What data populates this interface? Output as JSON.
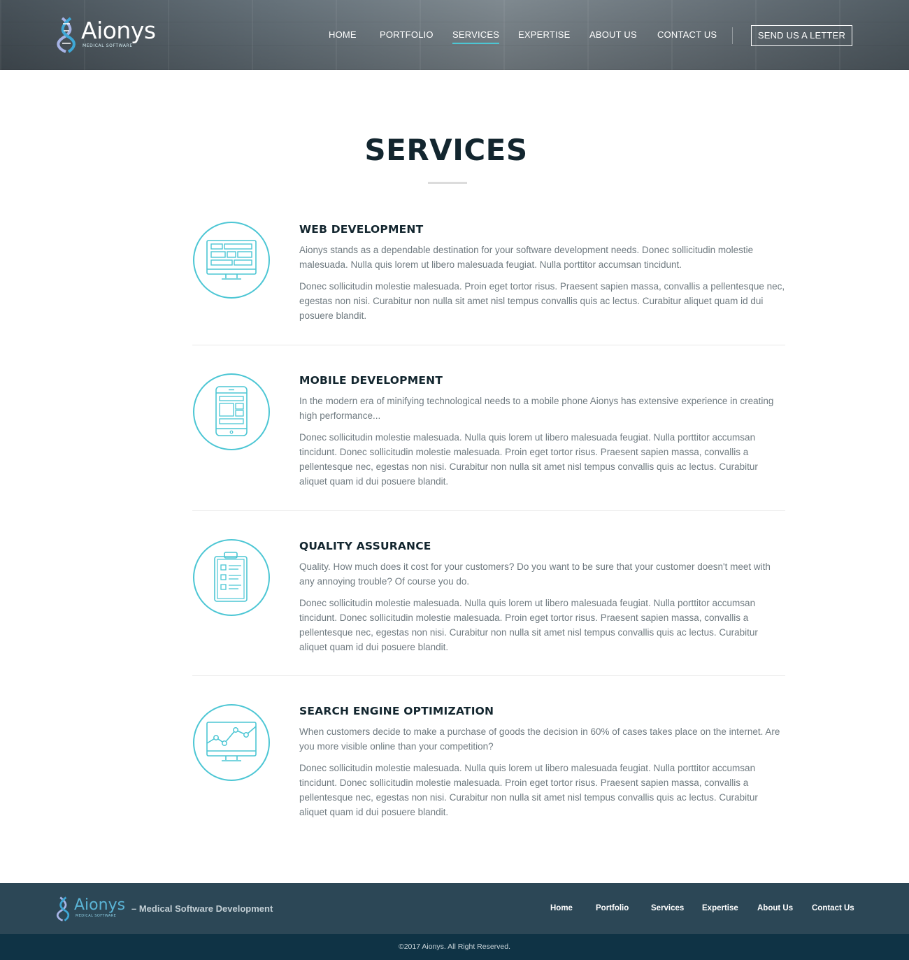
{
  "header": {
    "logo_name": "Aionys",
    "logo_sub": "MEDICAL SOFTWARE",
    "nav": [
      {
        "label": "HOME"
      },
      {
        "label": "PORTFOLIO"
      },
      {
        "label": "SERVICES",
        "active": true
      },
      {
        "label": "EXPERTISE"
      },
      {
        "label": "ABOUT US"
      },
      {
        "label": "CONTACT US"
      }
    ],
    "cta_label": "SEND US A LETTER"
  },
  "main": {
    "title": "SERVICES",
    "services": [
      {
        "icon": "monitor-layout-icon",
        "title": "WEB DEVELOPMENT",
        "paragraphs": [
          "Aionys stands as a dependable destination for your software development needs. Donec sollicitudin molestie malesuada. Nulla quis lorem ut libero malesuada feugiat. Nulla porttitor accumsan tincidunt.",
          "Donec sollicitudin molestie malesuada. Proin eget tortor risus. Praesent sapien massa, convallis a pellentesque nec, egestas non nisi. Curabitur non nulla sit amet nisl tempus convallis quis ac lectus. Curabitur aliquet quam id dui posuere blandit."
        ]
      },
      {
        "icon": "mobile-phone-icon",
        "title": "MOBILE DEVELOPMENT",
        "paragraphs": [
          "In the modern era of minifying technological needs to a mobile phone Aionys has extensive experience in creating high performance...",
          "Donec sollicitudin molestie malesuada. Nulla quis lorem ut libero malesuada feugiat. Nulla porttitor accumsan tincidunt. Donec sollicitudin molestie malesuada. Proin eget tortor risus. Praesent sapien massa, convallis a pellentesque nec, egestas non nisi. Curabitur non nulla sit amet nisl tempus convallis quis ac lectus. Curabitur aliquet quam id dui posuere blandit."
        ]
      },
      {
        "icon": "clipboard-checklist-icon",
        "title": "QUALITY ASSURANCE",
        "paragraphs": [
          "Quality. How much does it cost for your customers? Do you want to be sure that your customer doesn't meet with any annoying trouble? Of course you do.",
          "Donec sollicitudin molestie malesuada. Nulla quis lorem ut libero malesuada feugiat. Nulla porttitor accumsan tincidunt. Donec sollicitudin molestie malesuada. Proin eget tortor risus. Praesent sapien massa, convallis a pellentesque nec, egestas non nisi. Curabitur non nulla sit amet nisl tempus convallis quis ac lectus. Curabitur aliquet quam id dui posuere blandit."
        ]
      },
      {
        "icon": "monitor-chart-icon",
        "title": "SEARCH ENGINE OPTIMIZATION",
        "paragraphs": [
          "When customers decide to make a purchase of goods the decision in 60% of cases takes place on the internet. Are you more visible online than your competition?",
          "Donec sollicitudin molestie malesuada. Nulla quis lorem ut libero malesuada feugiat. Nulla porttitor accumsan tincidunt. Donec sollicitudin molestie malesuada. Proin eget tortor risus. Praesent sapien massa, convallis a pellentesque nec, egestas non nisi. Curabitur non nulla sit amet nisl tempus convallis quis ac lectus. Curabitur aliquet quam id dui posuere blandit."
        ]
      }
    ]
  },
  "footer": {
    "logo_name": "Aionys",
    "logo_sub": "MEDICAL SOFTWARE",
    "tagline": "– Medical Software Development",
    "nav": [
      {
        "label": "Home"
      },
      {
        "label": "Portfolio"
      },
      {
        "label": "Services"
      },
      {
        "label": "Expertise"
      },
      {
        "label": "About Us"
      },
      {
        "label": "Contact Us"
      }
    ],
    "copyright": "©2017 Aionys. All Right Reserved."
  },
  "colors": {
    "accent": "#4cc6d4",
    "heading": "#13262f",
    "body_text": "#6f7a80",
    "footer_bg": "#2c4756",
    "bottombar_bg": "#0f3345"
  }
}
